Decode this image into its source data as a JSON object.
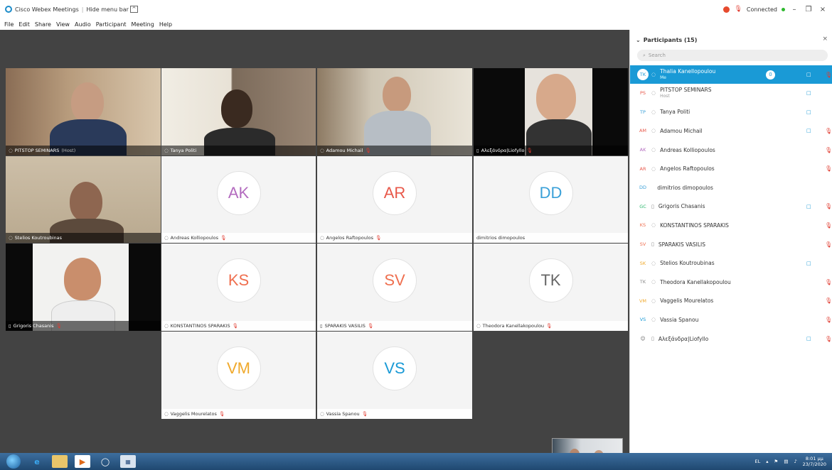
{
  "titlebar": {
    "app_title": "Cisco Webex Meetings",
    "hide_menu_bar": "Hide menu bar",
    "connection_status": "Connected"
  },
  "menu": [
    "File",
    "Edit",
    "Share",
    "View",
    "Audio",
    "Participant",
    "Meeting",
    "Help"
  ],
  "tiles": [
    {
      "name": "PITSTOP SEMINARS",
      "tag": "(Host)"
    },
    {
      "name": "Tanya Politi"
    },
    {
      "name": "Adamou Michail"
    },
    {
      "name": "Αλεξάνδρα|Liofyllo"
    },
    {
      "name": "Stelios Koutroubinas"
    },
    {
      "name": "Andreas Kolliopoulos",
      "initials": "AK"
    },
    {
      "name": "Angelos Raftopoulos",
      "initials": "AR"
    },
    {
      "name": "dimitrios dimopoulos",
      "initials": "DD"
    },
    {
      "name": "Grigoris Chasanis"
    },
    {
      "name": "KONSTANTINOS SPARAKIS",
      "initials": "KS"
    },
    {
      "name": "SPARAKIS VASILIS",
      "initials": "SV"
    },
    {
      "name": "Theodora Kanellakopoulou",
      "initials": "TK"
    },
    {
      "name": "Vaggelis Mourelatos",
      "initials": "VM"
    },
    {
      "name": "Vassia Spanou",
      "initials": "VS"
    }
  ],
  "avatar_colors": {
    "AK": "#b36bbf",
    "AR": "#e8584a",
    "DD": "#3aa0d8",
    "KS": "#ef6f4f",
    "SV": "#ef6f4f",
    "TK": "#666666",
    "VM": "#f0a92c",
    "VS": "#1a9ad6"
  },
  "panel": {
    "title": "Participants (15)",
    "search_placeholder": "Search",
    "participants": [
      {
        "initials": "TK",
        "name": "Thalia Kanellopoulou",
        "sub": "Me",
        "badge": "0"
      },
      {
        "initials": "PS",
        "name": "PITSTOP SEMINARS",
        "sub": "Host"
      },
      {
        "initials": "TP",
        "name": "Tanya Politi"
      },
      {
        "initials": "AM",
        "name": "Adamou Michail"
      },
      {
        "initials": "AK",
        "name": "Andreas Kolliopoulos"
      },
      {
        "initials": "AR",
        "name": "Angelos Raftopoulos"
      },
      {
        "initials": "DD",
        "name": "dimitrios dimopoulos"
      },
      {
        "initials": "GC",
        "name": "Grigoris Chasanis"
      },
      {
        "initials": "KS",
        "name": "KONSTANTINOS SPARAKIS"
      },
      {
        "initials": "SV",
        "name": "SPARAKIS VASILIS"
      },
      {
        "initials": "SK",
        "name": "Stelios Koutroubinas"
      },
      {
        "initials": "TK",
        "name": "Theodora Kanellakopoulou"
      },
      {
        "initials": "VM",
        "name": "Vaggelis Mourelatos"
      },
      {
        "initials": "VS",
        "name": "Vassia Spanou"
      },
      {
        "initials": "",
        "name": "Αλεξάνδρα|Liofyllo"
      }
    ]
  },
  "taskbar": {
    "lang": "EL",
    "time": "8:01 μμ",
    "date": "23/7/2020"
  }
}
